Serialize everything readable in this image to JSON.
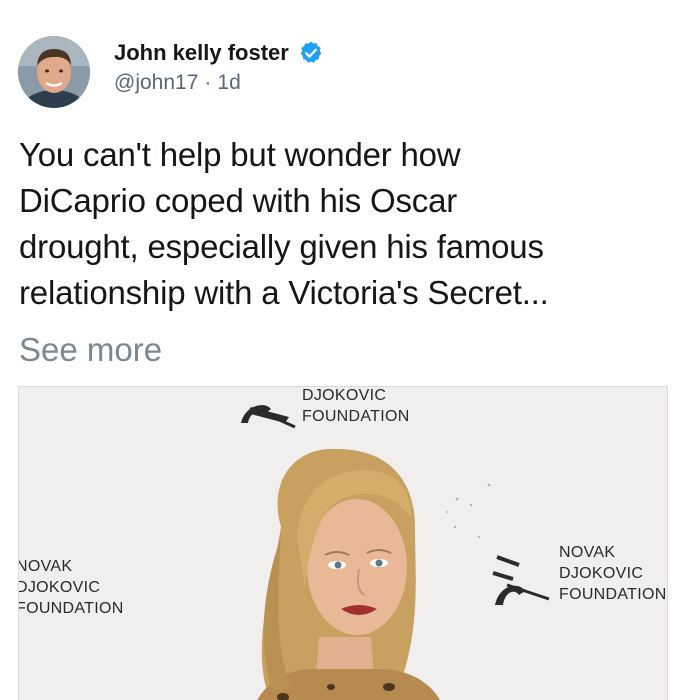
{
  "author": {
    "name": "John kelly foster",
    "handle": "@john17",
    "separator": "·",
    "time": "1d",
    "verified_color": "#1da1f2"
  },
  "tweet": {
    "lines": [
      "You can't help but wonder how",
      "DiCaprio coped with his Oscar",
      "drought, especially given his famous",
      "relationship with a Victoria's Secret..."
    ],
    "see_more": "See more"
  },
  "media": {
    "backdrop": {
      "top_logo": [
        "DJOKOVIC",
        "FOUNDATION"
      ],
      "left_logo": [
        "NOVAK",
        "DJOKOVIC",
        "FOUNDATION"
      ],
      "right_logo": [
        "NOVAK",
        "DJOKOVIC",
        "FOUNDATION"
      ]
    }
  }
}
